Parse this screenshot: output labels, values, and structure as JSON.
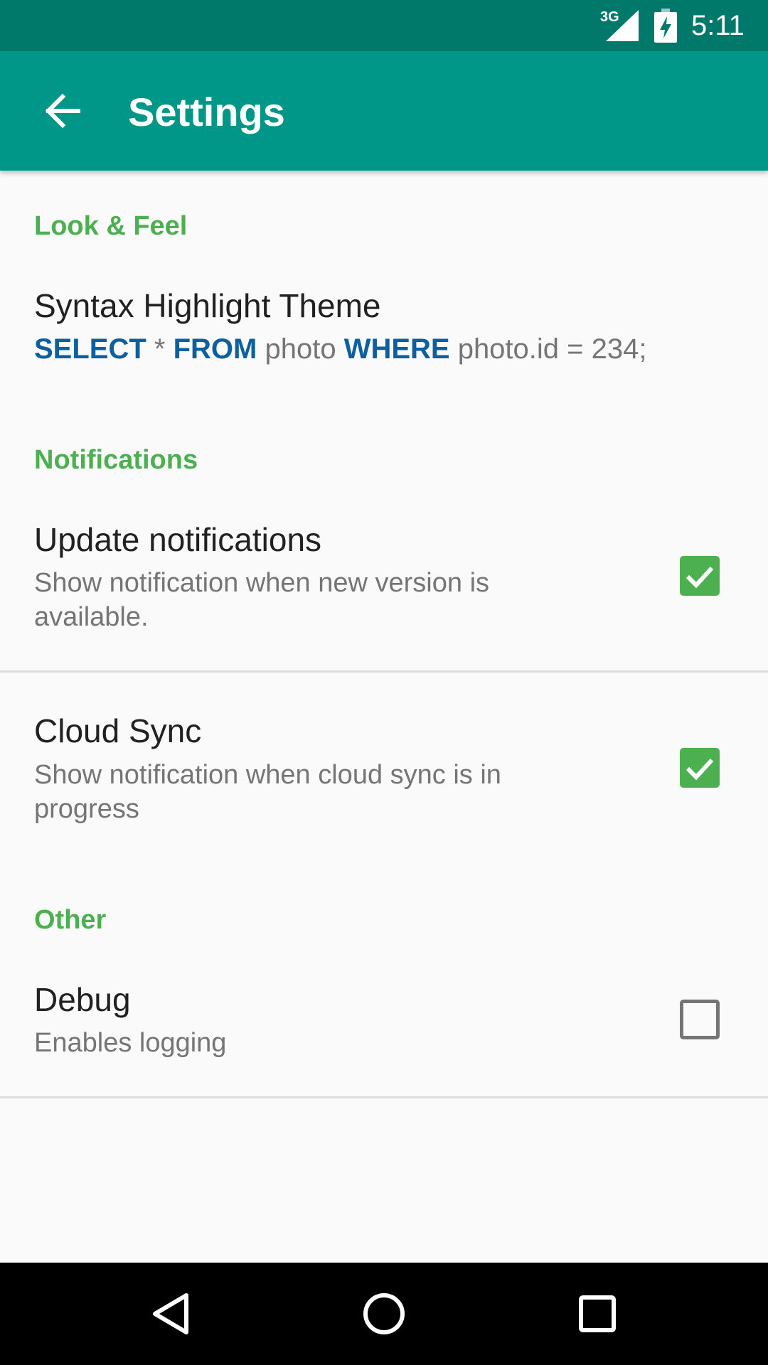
{
  "status_bar": {
    "network": "3G",
    "time": "5:11"
  },
  "toolbar": {
    "back_icon": "arrow-left-icon",
    "title": "Settings"
  },
  "sections": {
    "look_feel": {
      "header": "Look & Feel",
      "syntax_theme": {
        "title": "Syntax Highlight Theme",
        "preview": {
          "kw1": "SELECT",
          "t1": " * ",
          "kw2": "FROM",
          "t2": " photo ",
          "kw3": "WHERE",
          "t3": " photo.id = 234;"
        }
      }
    },
    "notifications": {
      "header": "Notifications",
      "update": {
        "title": "Update notifications",
        "summary": "Show notification when new version is available.",
        "checked": true
      },
      "cloud_sync": {
        "title": "Cloud Sync",
        "summary": "Show notification when cloud sync is in progress",
        "checked": true
      }
    },
    "other": {
      "header": "Other",
      "debug": {
        "title": "Debug",
        "summary": "Enables logging",
        "checked": false
      }
    }
  },
  "colors": {
    "status_bar": "#00796b",
    "toolbar": "#009688",
    "section_header": "#4caf50",
    "checkbox_checked": "#4caf50",
    "sql_keyword": "#0d5f9e"
  },
  "nav_bar": {
    "back_icon": "triangle-back-icon",
    "home_icon": "circle-home-icon",
    "recents_icon": "square-recents-icon"
  }
}
